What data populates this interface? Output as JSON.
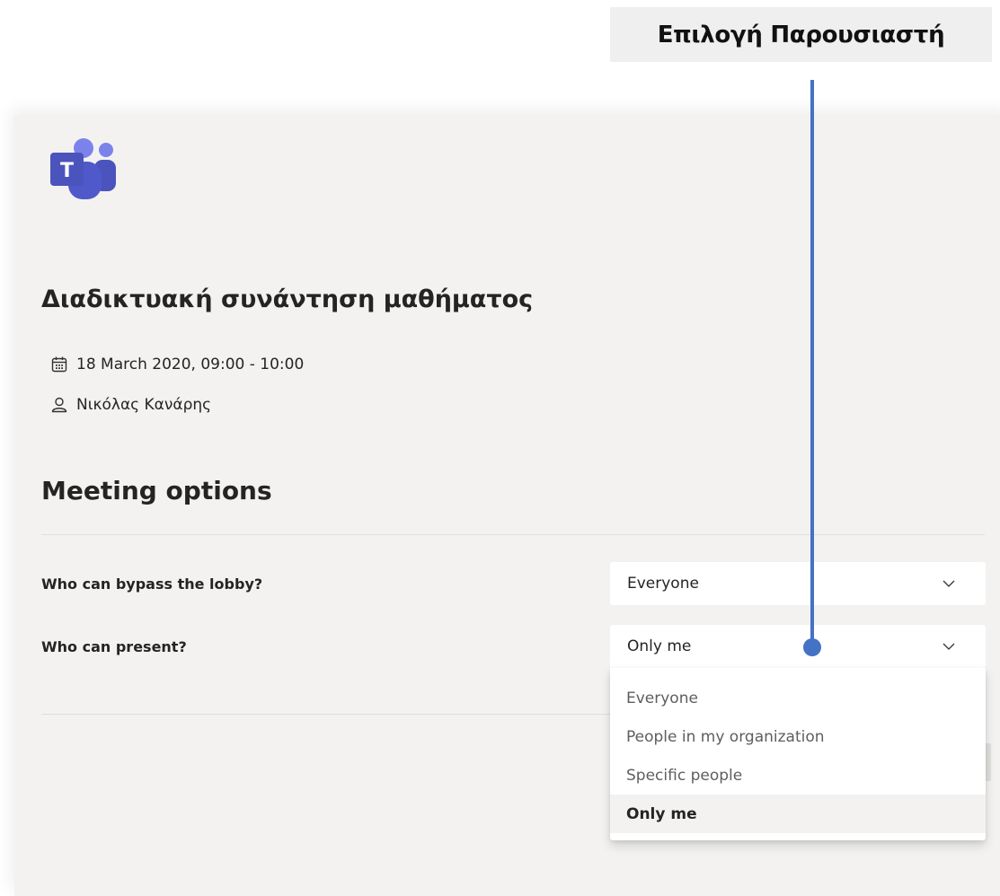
{
  "annotation": {
    "label": "Επιλογή Παρουσιαστή",
    "color": "#4472c4"
  },
  "app": {
    "logo_icon": "microsoft-teams-logo",
    "logo_letter": "T"
  },
  "meeting": {
    "title": "Διαδικτυακή συνάντηση μαθήματος",
    "datetime": "18 March 2020, 09:00 - 10:00",
    "datetime_icon": "calendar-icon",
    "organizer": "Νικόλας Κανάρης",
    "organizer_icon": "person-icon"
  },
  "options": {
    "heading": "Meeting options",
    "lobby": {
      "label": "Who can bypass the lobby?",
      "value": "Everyone"
    },
    "present": {
      "label": "Who can present?",
      "value": "Only me",
      "choices": [
        {
          "label": "Everyone",
          "selected": false
        },
        {
          "label": "People in my organization",
          "selected": false
        },
        {
          "label": "Specific people",
          "selected": false
        },
        {
          "label": "Only me",
          "selected": true
        }
      ]
    }
  }
}
